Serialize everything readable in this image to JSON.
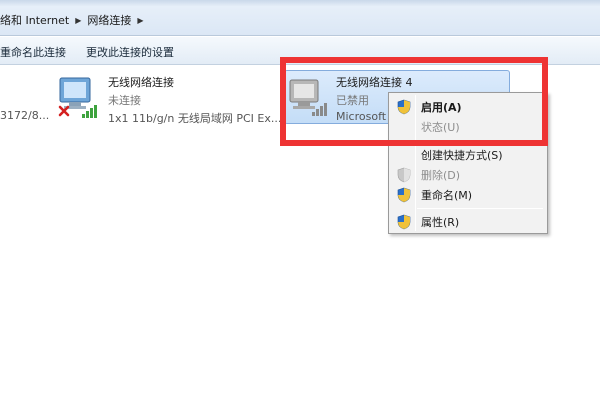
{
  "breadcrumb": {
    "parent": "络和 Internet",
    "current": "网络连接"
  },
  "commandbar": {
    "rename": "重命名此连接",
    "change_settings": "更改此连接的设置"
  },
  "connections": [
    {
      "name": "无线网络连接",
      "status": "未连接",
      "device": "1x1 11b/g/n 无线局域网 PCI Ex..."
    },
    {
      "name": "无线网络连接 4",
      "status": "已禁用",
      "device": "Microsoft"
    }
  ],
  "left_cut_text": "3172/8...",
  "context_menu": {
    "items": [
      {
        "label": "启用(A)",
        "icon": "shield-icon",
        "enabled": true,
        "bold": true
      },
      {
        "label": "状态(U)",
        "icon": "",
        "enabled": false
      },
      {
        "label": "创建快捷方式(S)",
        "icon": "",
        "enabled": true
      },
      {
        "label": "删除(D)",
        "icon": "shield-icon",
        "enabled": false
      },
      {
        "label": "重命名(M)",
        "icon": "shield-icon",
        "enabled": true
      },
      {
        "label": "属性(R)",
        "icon": "shield-icon",
        "enabled": true
      }
    ]
  },
  "colors": {
    "highlight": "#ee3333",
    "selection": "#c4ddf7"
  }
}
